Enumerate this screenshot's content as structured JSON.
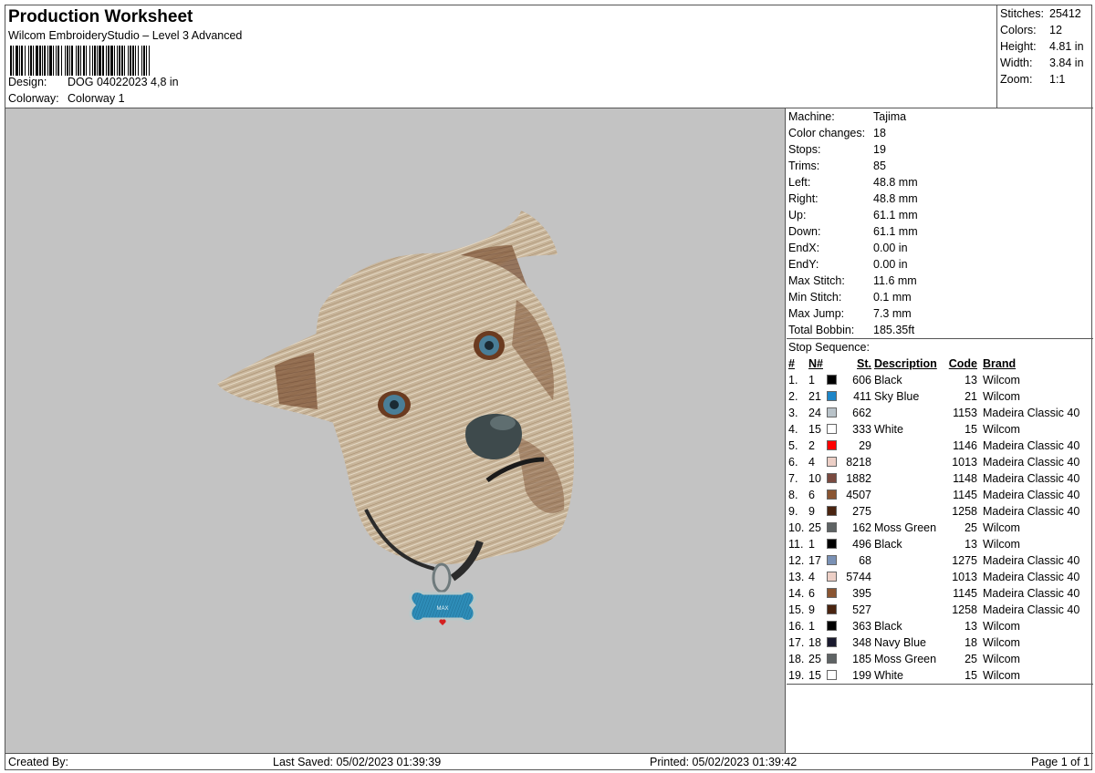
{
  "header": {
    "title": "Production Worksheet",
    "subtitle": "Wilcom EmbroideryStudio – Level 3 Advanced",
    "design_label": "Design:",
    "design_value": "DOG 04022023 4,8 in",
    "colorway_label": "Colorway:",
    "colorway_value": "Colorway 1"
  },
  "stats": [
    {
      "label": "Stitches:",
      "value": "25412"
    },
    {
      "label": "Colors:",
      "value": "12"
    },
    {
      "label": "Height:",
      "value": "4.81 in"
    },
    {
      "label": "Width:",
      "value": "3.84 in"
    },
    {
      "label": "Zoom:",
      "value": "1:1"
    }
  ],
  "machine": [
    {
      "label": "Machine:",
      "value": "Tajima"
    },
    {
      "label": "Color changes:",
      "value": "18"
    },
    {
      "label": "Stops:",
      "value": "19"
    },
    {
      "label": "Trims:",
      "value": "85"
    },
    {
      "label": "Left:",
      "value": "48.8 mm"
    },
    {
      "label": "Right:",
      "value": "48.8 mm"
    },
    {
      "label": "Up:",
      "value": "61.1 mm"
    },
    {
      "label": "Down:",
      "value": "61.1 mm"
    },
    {
      "label": "EndX:",
      "value": "0.00 in"
    },
    {
      "label": "EndY:",
      "value": "0.00 in"
    },
    {
      "label": "Max Stitch:",
      "value": "11.6 mm"
    },
    {
      "label": "Min Stitch:",
      "value": "0.1 mm"
    },
    {
      "label": "Max Jump:",
      "value": "7.3 mm"
    },
    {
      "label": "Total Bobbin:",
      "value": "185.35ft"
    }
  ],
  "stop_sequence": {
    "title": "Stop Sequence:",
    "headers": {
      "idx": "#",
      "n": "N#",
      "st": "St.",
      "desc": "Description",
      "code": "Code",
      "brand": "Brand"
    },
    "rows": [
      {
        "idx": "1.",
        "n": "1",
        "color": "#000000",
        "st": "606",
        "desc": "Black",
        "code": "13",
        "brand": "Wilcom"
      },
      {
        "idx": "2.",
        "n": "21",
        "color": "#1e86c8",
        "st": "411",
        "desc": "Sky Blue",
        "code": "21",
        "brand": "Wilcom"
      },
      {
        "idx": "3.",
        "n": "24",
        "color": "#b9c3c9",
        "st": "662",
        "desc": "",
        "code": "1153",
        "brand": "Madeira Classic 40"
      },
      {
        "idx": "4.",
        "n": "15",
        "color": "#ffffff",
        "st": "333",
        "desc": "White",
        "code": "15",
        "brand": "Wilcom"
      },
      {
        "idx": "5.",
        "n": "2",
        "color": "#ff0000",
        "st": "29",
        "desc": "",
        "code": "1146",
        "brand": "Madeira Classic 40"
      },
      {
        "idx": "6.",
        "n": "4",
        "color": "#eccfc6",
        "st": "8218",
        "desc": "",
        "code": "1013",
        "brand": "Madeira Classic 40"
      },
      {
        "idx": "7.",
        "n": "10",
        "color": "#7a4a40",
        "st": "1882",
        "desc": "",
        "code": "1148",
        "brand": "Madeira Classic 40"
      },
      {
        "idx": "8.",
        "n": "6",
        "color": "#8a5532",
        "st": "4507",
        "desc": "",
        "code": "1145",
        "brand": "Madeira Classic 40"
      },
      {
        "idx": "9.",
        "n": "9",
        "color": "#4a2410",
        "st": "275",
        "desc": "",
        "code": "1258",
        "brand": "Madeira Classic 40"
      },
      {
        "idx": "10.",
        "n": "25",
        "color": "#5e6364",
        "st": "162",
        "desc": "Moss Green",
        "code": "25",
        "brand": "Wilcom"
      },
      {
        "idx": "11.",
        "n": "1",
        "color": "#000000",
        "st": "496",
        "desc": "Black",
        "code": "13",
        "brand": "Wilcom"
      },
      {
        "idx": "12.",
        "n": "17",
        "color": "#7a91b5",
        "st": "68",
        "desc": "",
        "code": "1275",
        "brand": "Madeira Classic 40"
      },
      {
        "idx": "13.",
        "n": "4",
        "color": "#eccfc6",
        "st": "5744",
        "desc": "",
        "code": "1013",
        "brand": "Madeira Classic 40"
      },
      {
        "idx": "14.",
        "n": "6",
        "color": "#8a5532",
        "st": "395",
        "desc": "",
        "code": "1145",
        "brand": "Madeira Classic 40"
      },
      {
        "idx": "15.",
        "n": "9",
        "color": "#4a2410",
        "st": "527",
        "desc": "",
        "code": "1258",
        "brand": "Madeira Classic 40"
      },
      {
        "idx": "16.",
        "n": "1",
        "color": "#000000",
        "st": "363",
        "desc": "Black",
        "code": "13",
        "brand": "Wilcom"
      },
      {
        "idx": "17.",
        "n": "18",
        "color": "#1a1a2e",
        "st": "348",
        "desc": "Navy Blue",
        "code": "18",
        "brand": "Wilcom"
      },
      {
        "idx": "18.",
        "n": "25",
        "color": "#5e6364",
        "st": "185",
        "desc": "Moss Green",
        "code": "25",
        "brand": "Wilcom"
      },
      {
        "idx": "19.",
        "n": "15",
        "color": "#ffffff",
        "st": "199",
        "desc": "White",
        "code": "15",
        "brand": "Wilcom"
      }
    ]
  },
  "preview": {
    "background": "#c3c3c3",
    "tag_text": "MAX"
  },
  "footer": {
    "created_by": "Created By:",
    "last_saved": "Last Saved: 05/02/2023 01:39:39",
    "printed": "Printed: 05/02/2023 01:39:42",
    "page": "Page 1 of 1"
  }
}
